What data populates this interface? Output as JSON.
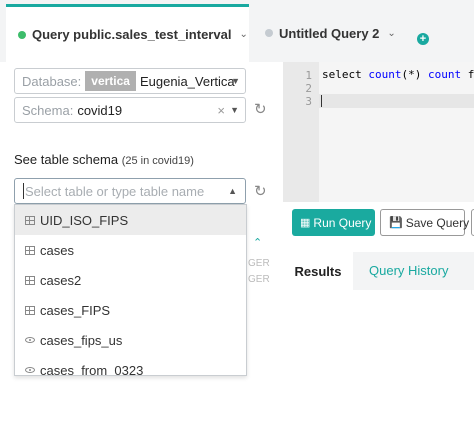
{
  "tabs": [
    {
      "label": "Query public.sales_test_interval",
      "status_color": "#3dbd6b"
    },
    {
      "label": "Untitled Query 2",
      "status_color": "#c5cbd1"
    }
  ],
  "add_tab_symbol": "+",
  "database": {
    "label": "Database:",
    "engine": "vertica",
    "value": "Eugenia_Vertica"
  },
  "schema": {
    "label": "Schema:",
    "value": "covid19",
    "clear": "×"
  },
  "table_schema": {
    "title": "See table schema",
    "count": "(25 in covid19)"
  },
  "table_search": {
    "placeholder": "Select table or type table name"
  },
  "table_options": [
    {
      "name": "UID_ISO_FIPS",
      "kind": "table"
    },
    {
      "name": "cases",
      "kind": "table"
    },
    {
      "name": "cases2",
      "kind": "table"
    },
    {
      "name": "cases_FIPS",
      "kind": "table"
    },
    {
      "name": "cases_fips_us",
      "kind": "view"
    },
    {
      "name": "cases_from_0323",
      "kind": "view"
    }
  ],
  "background_text": [
    "GER",
    "GER"
  ],
  "editor": {
    "line_numbers": [
      "1",
      "2",
      "3"
    ],
    "code_select": "select",
    "code_count": "count",
    "code_args": "(*)",
    "code_alias": "count",
    "code_tail": "fr"
  },
  "buttons": {
    "run": "Run Query",
    "save": "Save Query"
  },
  "result_tabs": {
    "results": "Results",
    "history": "Query History"
  },
  "colors": {
    "accent": "#19a9a0",
    "run_button": "#1aaa9f",
    "keyword": "#0000ff"
  }
}
